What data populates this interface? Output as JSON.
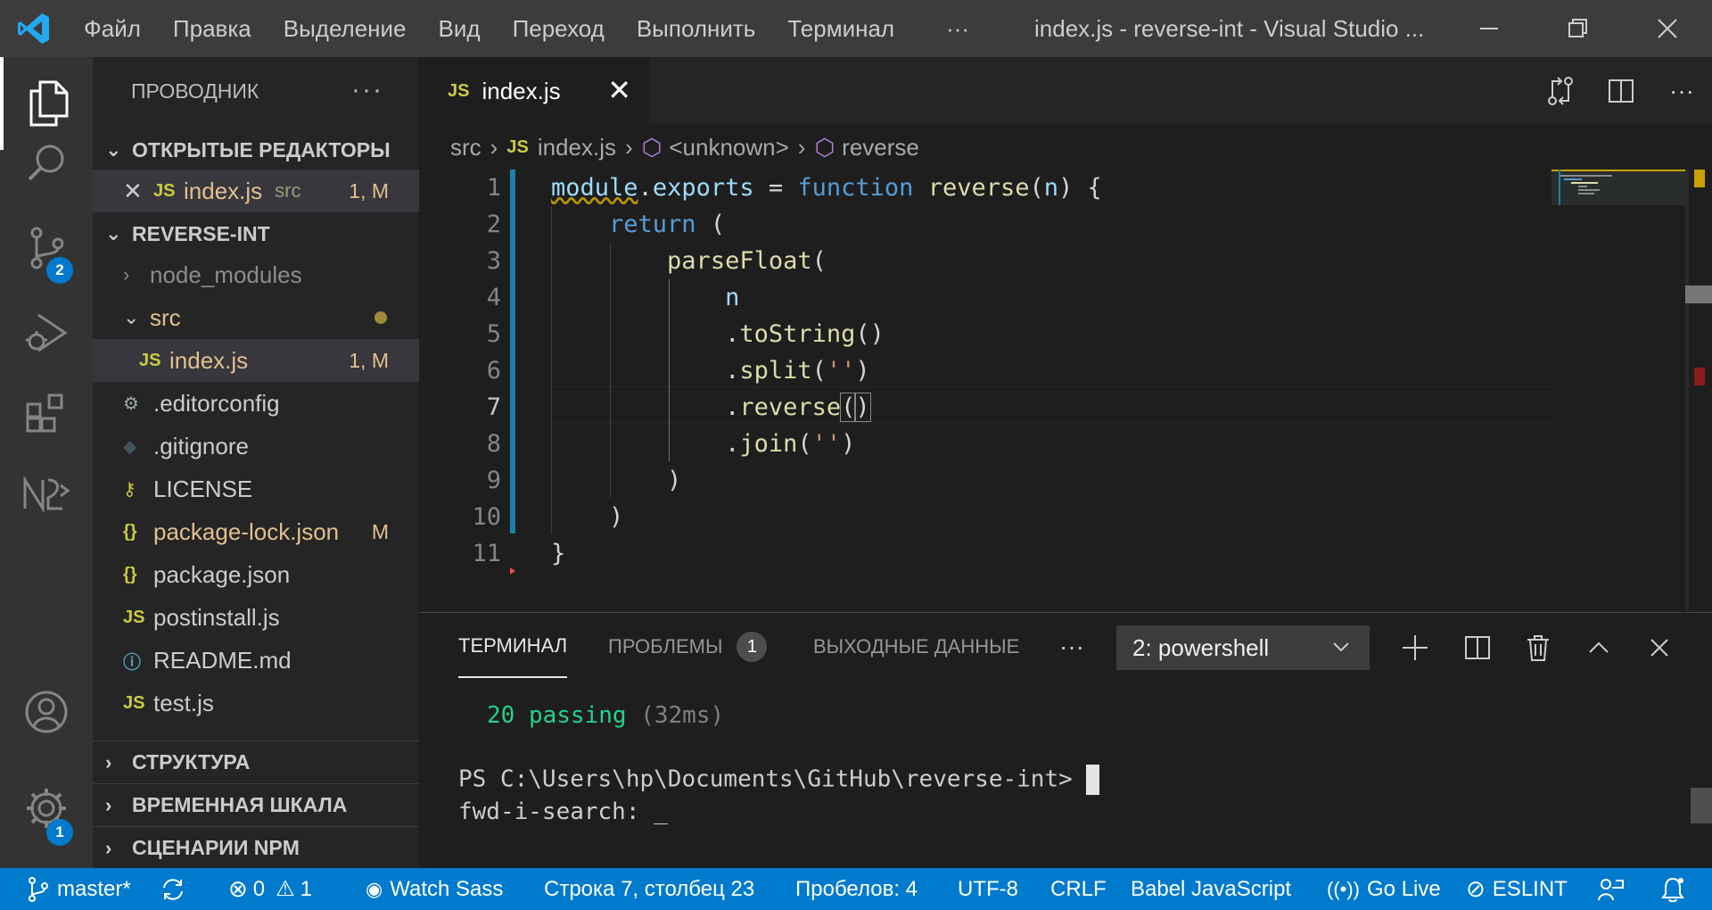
{
  "colors": {
    "accent": "#007acc",
    "statusbar": "#007acc",
    "titlebar": "#3c3c3c",
    "sidebar": "#252526",
    "editor": "#1e1e1e"
  },
  "titlebar": {
    "menu": [
      "Файл",
      "Правка",
      "Выделение",
      "Вид",
      "Переход",
      "Выполнить",
      "Терминал"
    ],
    "more": "···",
    "title": "index.js - reverse-int - Visual Studio ..."
  },
  "activity": {
    "scm_badge": "2",
    "settings_badge": "1"
  },
  "sidebar": {
    "header": "ПРОВОДНИК",
    "header_more": "···",
    "open_editors": {
      "title": "ОТКРЫТЫЕ РЕДАКТОРЫ",
      "items": [
        {
          "icon": "JS",
          "name": "index.js",
          "folder": "src",
          "status": "1, M"
        }
      ]
    },
    "project": {
      "title": "REVERSE-INT",
      "items": [
        {
          "name": "node_modules"
        },
        {
          "name": "src"
        },
        {
          "icon": "JS",
          "name": "index.js",
          "status": "1, M"
        },
        {
          "name": ".editorconfig"
        },
        {
          "name": ".gitignore"
        },
        {
          "name": "LICENSE"
        },
        {
          "icon": "{}",
          "name": "package-lock.json",
          "status": "M"
        },
        {
          "icon": "{}",
          "name": "package.json"
        },
        {
          "icon": "JS",
          "name": "postinstall.js"
        },
        {
          "name": "README.md"
        },
        {
          "icon": "JS",
          "name": "test.js"
        }
      ]
    },
    "sections": [
      "СТРУКТУРА",
      "ВРЕМЕННАЯ ШКАЛА",
      "СЦЕНАРИИ NPM"
    ]
  },
  "editor": {
    "tab": {
      "icon": "JS",
      "label": "index.js"
    },
    "breadcrumb": {
      "folder": "src",
      "file_icon": "JS",
      "file": "index.js",
      "scope1": "<unknown>",
      "scope2": "reverse"
    },
    "line_numbers": [
      "1",
      "2",
      "3",
      "4",
      "5",
      "6",
      "7",
      "8",
      "9",
      "10",
      "11"
    ],
    "current_line": 7
  },
  "panel": {
    "tabs": {
      "terminal": "ТЕРМИНАЛ",
      "problems": "ПРОБЛЕМЫ",
      "problems_count": "1",
      "output": "ВЫХОДНЫЕ ДАННЫЕ",
      "more": "···"
    },
    "terminal_select": "2: powershell",
    "terminal": {
      "passing_count": "20 passing",
      "passing_time": "(32ms)",
      "prompt": "PS C:\\Users\\hp\\Documents\\GitHub\\reverse-int>",
      "search": "fwd-i-search: _"
    }
  },
  "statusbar": {
    "branch": "master*",
    "errors": "0",
    "warnings": "1",
    "watch_sass": "Watch Sass",
    "position": "Строка 7, столбец 23",
    "indent": "Пробелов: 4",
    "encoding": "UTF-8",
    "eol": "CRLF",
    "language": "Babel JavaScript",
    "go_live": "Go Live",
    "eslint": "ESLINT"
  }
}
